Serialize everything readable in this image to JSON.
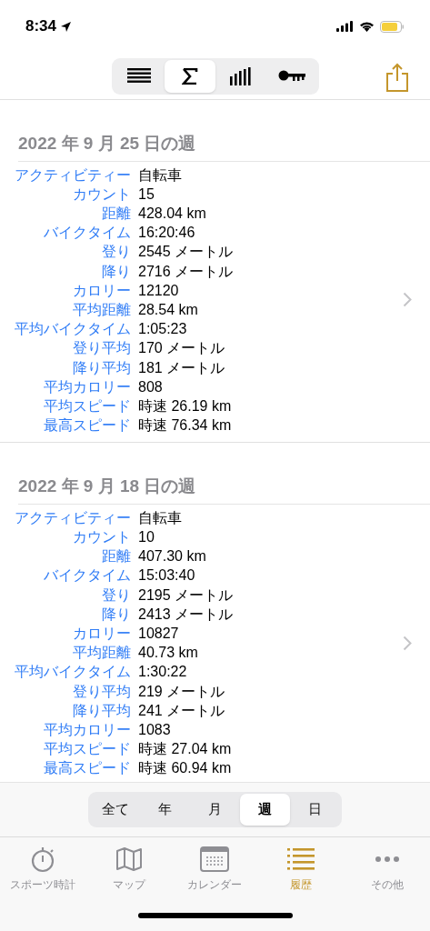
{
  "status_bar": {
    "time": "8:34"
  },
  "toolbar": {
    "segments": [
      {
        "kind": "list",
        "selected": false
      },
      {
        "kind": "sigma",
        "selected": true
      },
      {
        "kind": "bars",
        "selected": false
      },
      {
        "kind": "key",
        "selected": false
      }
    ]
  },
  "weeks": [
    {
      "title": "2022 年 9 月 25 日の週",
      "rows": [
        {
          "label": "アクティビティー",
          "value": "自転車"
        },
        {
          "label": "カウント",
          "value": "15"
        },
        {
          "label": "距離",
          "value": "428.04 km"
        },
        {
          "label": "バイクタイム",
          "value": "16:20:46"
        },
        {
          "label": "登り",
          "value": "2545 メートル"
        },
        {
          "label": "降り",
          "value": "2716 メートル"
        },
        {
          "label": "カロリー",
          "value": "12120"
        },
        {
          "label": "平均距離",
          "value": "28.54 km"
        },
        {
          "label": "平均バイクタイム",
          "value": "1:05:23"
        },
        {
          "label": "登り平均",
          "value": "170 メートル"
        },
        {
          "label": "降り平均",
          "value": "181 メートル"
        },
        {
          "label": "平均カロリー",
          "value": "808"
        },
        {
          "label": "平均スピード",
          "value": "時速 26.19 km"
        },
        {
          "label": "最高スピード",
          "value": "時速 76.34 km"
        }
      ]
    },
    {
      "title": "2022 年 9 月 18 日の週",
      "rows": [
        {
          "label": "アクティビティー",
          "value": "自転車"
        },
        {
          "label": "カウント",
          "value": "10"
        },
        {
          "label": "距離",
          "value": "407.30 km"
        },
        {
          "label": "バイクタイム",
          "value": "15:03:40"
        },
        {
          "label": "登り",
          "value": "2195 メートル"
        },
        {
          "label": "降り",
          "value": "2413 メートル"
        },
        {
          "label": "カロリー",
          "value": "10827"
        },
        {
          "label": "平均距離",
          "value": "40.73 km"
        },
        {
          "label": "平均バイクタイム",
          "value": "1:30:22"
        },
        {
          "label": "登り平均",
          "value": "219 メートル"
        },
        {
          "label": "降り平均",
          "value": "241 メートル"
        },
        {
          "label": "平均カロリー",
          "value": "1083"
        },
        {
          "label": "平均スピード",
          "value": "時速 27.04 km"
        },
        {
          "label": "最高スピード",
          "value": "時速 60.94 km"
        }
      ]
    }
  ],
  "period_filter": [
    {
      "label": "全て",
      "selected": false
    },
    {
      "label": "年",
      "selected": false
    },
    {
      "label": "月",
      "selected": false
    },
    {
      "label": "週",
      "selected": true
    },
    {
      "label": "日",
      "selected": false
    }
  ],
  "tab_bar": [
    {
      "kind": "stopwatch",
      "label": "スポーツ時計",
      "selected": false
    },
    {
      "kind": "map",
      "label": "マップ",
      "selected": false
    },
    {
      "kind": "calendar",
      "label": "カレンダー",
      "selected": false
    },
    {
      "kind": "list",
      "label": "履歴",
      "selected": true
    },
    {
      "kind": "more",
      "label": "その他",
      "selected": false
    }
  ]
}
